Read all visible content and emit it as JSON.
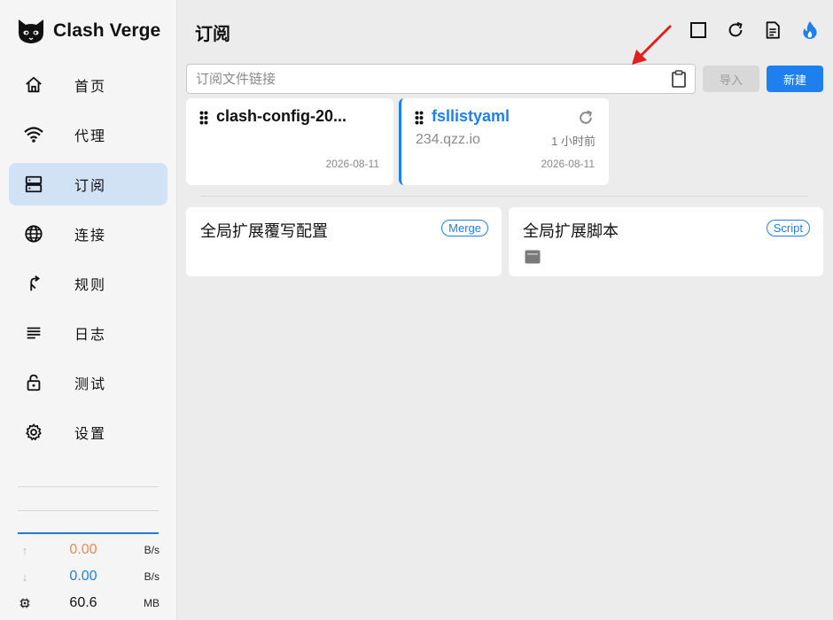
{
  "brand": {
    "name": "Clash Verge"
  },
  "nav": {
    "items": [
      {
        "label": "首页",
        "icon": "home-icon"
      },
      {
        "label": "代理",
        "icon": "wifi-icon"
      },
      {
        "label": "订阅",
        "icon": "dns-icon",
        "active": true
      },
      {
        "label": "连接",
        "icon": "globe-icon"
      },
      {
        "label": "规则",
        "icon": "fork-icon"
      },
      {
        "label": "日志",
        "icon": "lines-icon"
      },
      {
        "label": "测试",
        "icon": "lock-icon"
      },
      {
        "label": "设置",
        "icon": "gear-icon"
      }
    ]
  },
  "traffic": {
    "upload": {
      "value": "0.00",
      "unit": "B/s",
      "color": "#f0884d"
    },
    "download": {
      "value": "0.00",
      "unit": "B/s",
      "color": "#1e80ee"
    },
    "memory": {
      "value": "60.6",
      "unit": "MB"
    }
  },
  "page": {
    "title": "订阅"
  },
  "search": {
    "placeholder": "订阅文件链接",
    "value": ""
  },
  "buttons": {
    "import": "导入",
    "new": "新建"
  },
  "profiles": [
    {
      "name": "clash-config-20...",
      "host": "",
      "ago": "",
      "date": "2026-08-11",
      "selected": false
    },
    {
      "name": "fsllistyaml",
      "host": "234.qzz.io",
      "ago": "1 小时前",
      "date": "2026-08-11",
      "selected": true
    }
  ],
  "enhancements": [
    {
      "title": "全局扩展覆写配置",
      "badge": "Merge"
    },
    {
      "title": "全局扩展脚本",
      "badge": "Script"
    }
  ],
  "colors": {
    "accent": "#1e80ee",
    "annotation_arrow": "#e0201f"
  }
}
